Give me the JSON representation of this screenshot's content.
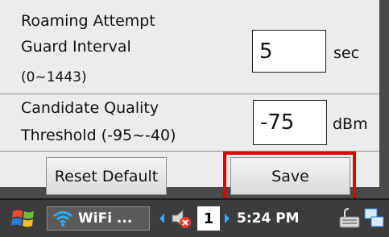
{
  "settings": {
    "roaming": {
      "label_line1": "Roaming Attempt",
      "label_line2": "Guard Interval",
      "label_line3": "(0~1443)",
      "value": "5",
      "unit": "sec"
    },
    "candidate": {
      "label_line1": "Candidate Quality",
      "label_line2": "Threshold (-95~-40)",
      "value": "-75",
      "unit": "dBm"
    }
  },
  "buttons": {
    "reset_label": "Reset Default",
    "save_label": "Save"
  },
  "taskbar": {
    "wifi_label": "WiFi ...",
    "page_number": "1",
    "time": "5:24 PM"
  },
  "colors": {
    "highlight": "#e00000",
    "taskbar": "#3c3c3c",
    "panel": "#ececec"
  },
  "icons": [
    "windows-start-icon",
    "wifi-icon",
    "left-arrow-icon",
    "speaker-muted-icon",
    "right-arrow-icon",
    "keyboard-icon",
    "network-icon"
  ]
}
